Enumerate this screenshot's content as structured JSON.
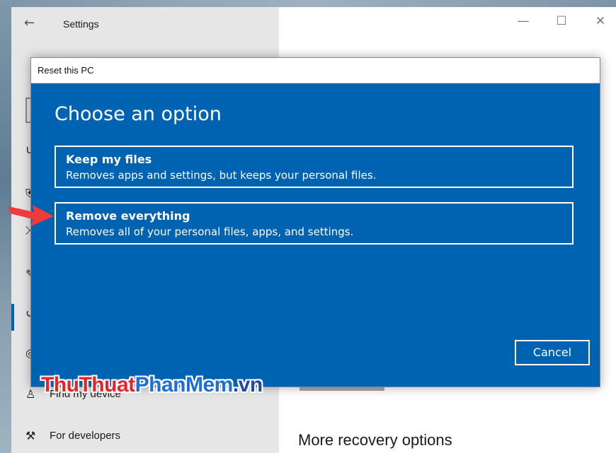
{
  "settings": {
    "app_title": "Settings",
    "back_icon": "back-arrow-icon",
    "window_controls": {
      "minimize": "—",
      "maximize": "☐",
      "close": "✕"
    },
    "sidebar": {
      "items": [
        {
          "label": "Find my device",
          "icon": "person-location-icon"
        },
        {
          "label": "For developers",
          "icon": "developer-tools-icon"
        }
      ]
    },
    "main": {
      "section_heading": "More recovery options"
    }
  },
  "dialog": {
    "title": "Reset this PC",
    "heading": "Choose an option",
    "options": [
      {
        "title": "Keep my files",
        "description": "Removes apps and settings, but keeps your personal files."
      },
      {
        "title": "Remove everything",
        "description": "Removes all of your personal files, apps, and settings."
      }
    ],
    "cancel_label": "Cancel"
  },
  "watermark": {
    "part1": "ThuThuat",
    "part2": "PhanMem",
    "part3": ".vn"
  },
  "colors": {
    "dialog_blue": "#0063b1",
    "sidebar_bg": "#e6e6e6",
    "arrow_red": "#ef3b3b"
  }
}
